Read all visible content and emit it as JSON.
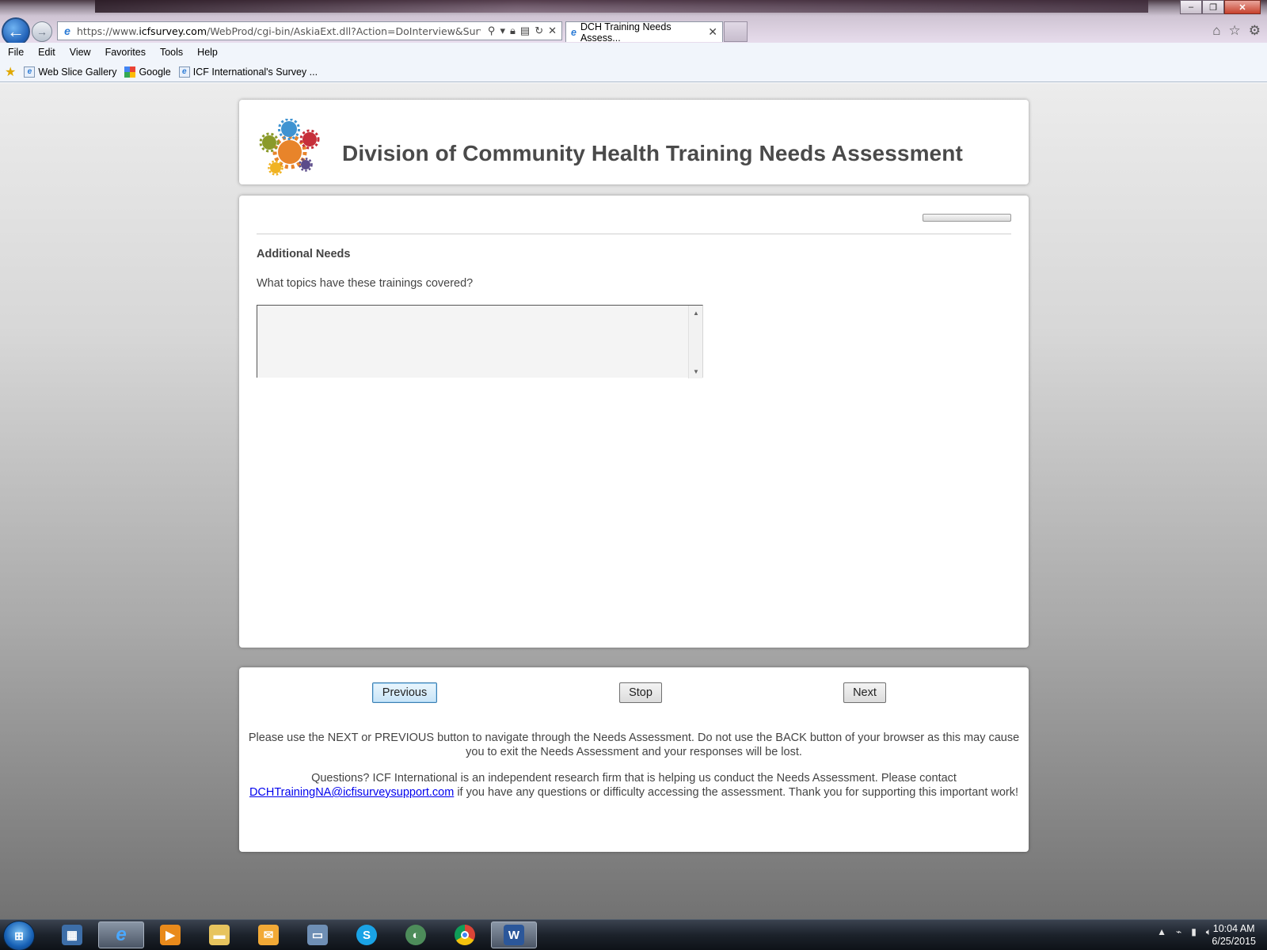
{
  "browser": {
    "url_prefix": "https://www.",
    "url_domain": "icfsurvey.com",
    "url_path": "/WebProd/cgi-bin/AskiaExt.dll?Action=DoInterview&Survey=HRRNH",
    "tab_title": "DCH Training Needs Assess...",
    "menu": [
      "File",
      "Edit",
      "View",
      "Favorites",
      "Tools",
      "Help"
    ],
    "favorites": [
      "Web Slice Gallery",
      "Google",
      "ICF International's Survey ..."
    ]
  },
  "header": {
    "title": "Division of Community Health Training Needs Assessment"
  },
  "question": {
    "progress_fraction": 0.0,
    "section_title": "Additional Needs",
    "text": "What topics have these trainings covered?",
    "answer_value": ""
  },
  "navigation": {
    "previous_label": "Previous",
    "stop_label": "Stop",
    "next_label": "Next",
    "instructions": "Please use the NEXT or PREVIOUS button to navigate through the Needs Assessment. Do not use the BACK button of your browser as this may cause you to exit the Needs Assessment and your responses will be lost.",
    "questions_before": "Questions? ICF International is an independent research firm that is helping us conduct the Needs Assessment. Please contact",
    "contact_email": "DCHTrainingNA@icfisurveysupport.com",
    "questions_after": "if you have any questions or difficulty accessing the assessment. Thank you for supporting this important work!"
  },
  "taskbar": {
    "time": "10:04 AM",
    "date": "6/25/2015"
  },
  "colors": {
    "title_text": "#4a4a4a",
    "link": "#0000ee",
    "ie_blue": "#2b7bd6"
  }
}
